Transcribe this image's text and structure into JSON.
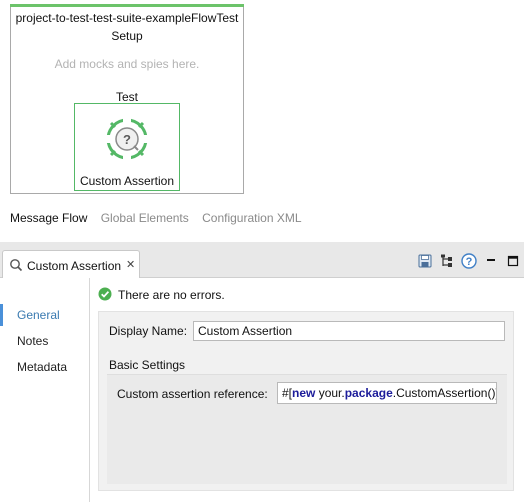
{
  "flow": {
    "title": "project-to-test-test-suite-exampleFlowTest",
    "setup_label": "Setup",
    "setup_hint": "Add mocks and spies here.",
    "test_label": "Test",
    "processor": {
      "label": "Custom Assertion",
      "icon": "custom-assertion-icon"
    }
  },
  "editor_tabs": [
    {
      "label": "Message Flow",
      "active": true
    },
    {
      "label": "Global Elements",
      "active": false
    },
    {
      "label": "Configuration XML",
      "active": false
    }
  ],
  "properties_view": {
    "tab_label": "Custom Assertion",
    "tab_icon": "magnifier-icon",
    "actions": [
      "save-icon",
      "tree-icon",
      "help-icon",
      "minimize-icon",
      "maximize-icon"
    ],
    "nav": [
      {
        "label": "General",
        "active": true
      },
      {
        "label": "Notes",
        "active": false
      },
      {
        "label": "Metadata",
        "active": false
      }
    ],
    "status": "There are no errors.",
    "display_name_label": "Display Name:",
    "display_name_value": "Custom Assertion",
    "basic_settings_label": "Basic Settings",
    "assertion_ref_label": "Custom assertion reference:",
    "assertion_ref_value": {
      "prefix": "#[",
      "kw_new": "new",
      "mid": " your.",
      "kw_package": "package",
      "suffix": ".CustomAssertion()]"
    }
  },
  "colors": {
    "accent_green": "#54b866",
    "nav_active": "#3a7ab0",
    "keyword": "#1c1c9a",
    "hint_gray": "#b3b3b3"
  }
}
